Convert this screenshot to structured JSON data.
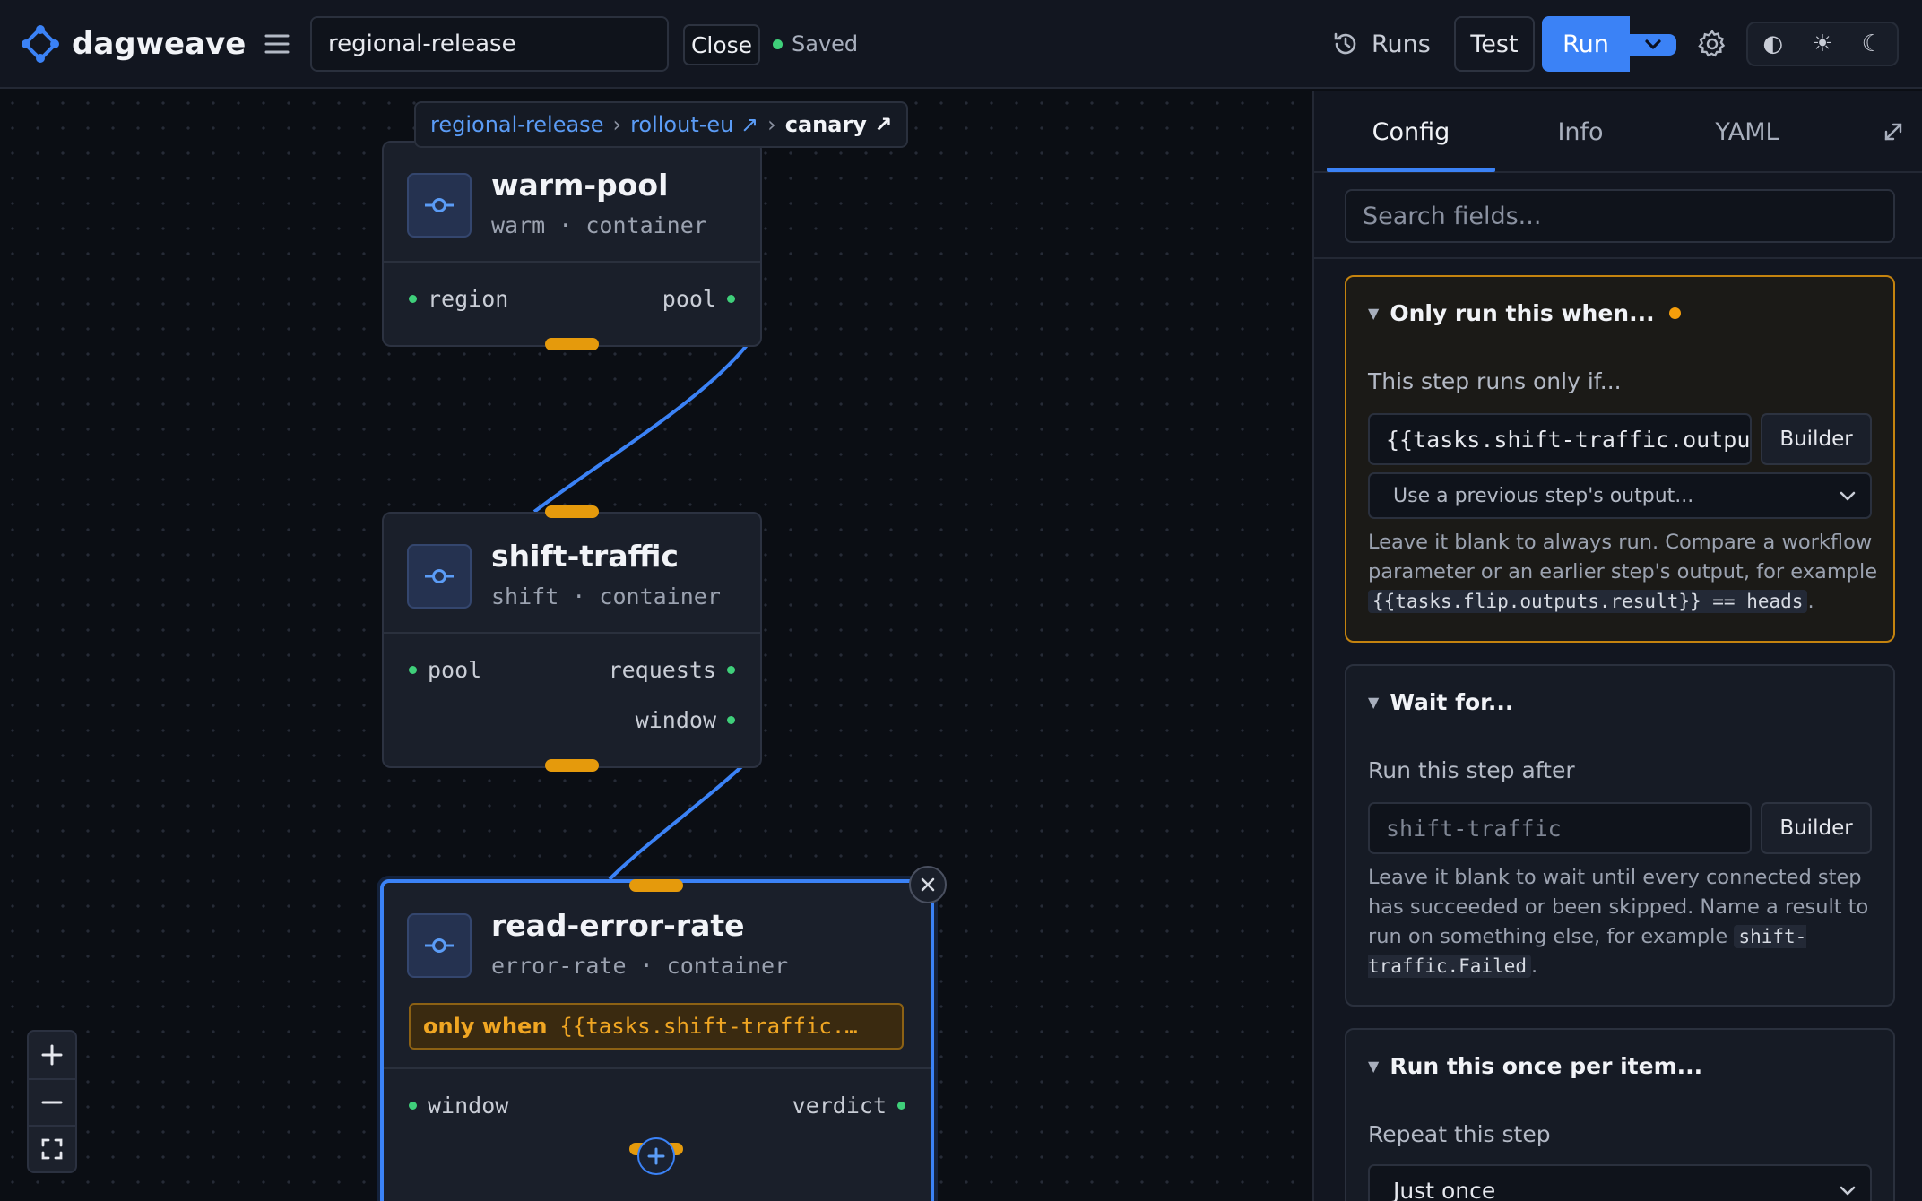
{
  "app": {
    "brand": "dagweave",
    "workflow_name": "regional-release",
    "close_label": "Close",
    "save_status": "Saved",
    "runs_label": "Runs",
    "test_label": "Test",
    "run_label": "Run",
    "theme_icons": [
      "◐",
      "☀",
      "☾"
    ]
  },
  "breadcrumb": {
    "items": [
      "regional-release",
      "rollout-eu ↗",
      "canary ↗"
    ],
    "separator": "›"
  },
  "nodes": [
    {
      "title": "warm-pool",
      "subtitle": "warm · container",
      "inputs": [
        "region"
      ],
      "outputs": [
        "pool"
      ]
    },
    {
      "title": "shift-traffic",
      "subtitle": "shift · container",
      "inputs": [
        "pool"
      ],
      "outputs": [
        "requests",
        "window"
      ]
    },
    {
      "title": "read-error-rate",
      "subtitle": "error-rate · container",
      "condition_label": "only when",
      "condition_value": "{{tasks.shift-traffic.…",
      "inputs": [
        "window"
      ],
      "outputs": [
        "verdict"
      ]
    }
  ],
  "panel": {
    "tabs": [
      "Config",
      "Info",
      "YAML"
    ],
    "active_tab": "Config",
    "search_placeholder": "Search fields...",
    "when": {
      "title": "Only run this when...",
      "label": "This step runs only if...",
      "value": "{{tasks.shift-traffic.outpu",
      "builder_label": "Builder",
      "select_placeholder": "Use a previous step's output...",
      "help_prefix": "Leave it blank to always run. Compare a workflow parameter or an earlier step's output, for example ",
      "help_code": "{{tasks.flip.outputs.result}} == heads",
      "help_suffix": "."
    },
    "wait": {
      "title": "Wait for...",
      "label": "Run this step after",
      "placeholder": "shift-traffic",
      "builder_label": "Builder",
      "help_prefix": "Leave it blank to wait until every connected step has succeeded or been skipped. Name a result to run on something else, for example ",
      "help_code": "shift-traffic.Failed",
      "help_suffix": "."
    },
    "loop": {
      "title": "Run this once per item...",
      "label": "Repeat this step",
      "value": "Just once"
    }
  },
  "colors": {
    "accent": "#3b82f6",
    "warning": "#f59e0b",
    "success": "#3fcf7a",
    "handle": "#e59a0c"
  },
  "icons": {
    "logo": "dagweave-logo-icon",
    "menu": "hamburger-icon",
    "history": "history-icon",
    "settings": "gear-icon",
    "node": "commit-node-icon",
    "expand": "expand-icon",
    "close": "close-icon",
    "add": "plus-icon",
    "zoom_in": "plus-icon",
    "zoom_out": "minus-icon",
    "fit": "fit-view-icon"
  }
}
